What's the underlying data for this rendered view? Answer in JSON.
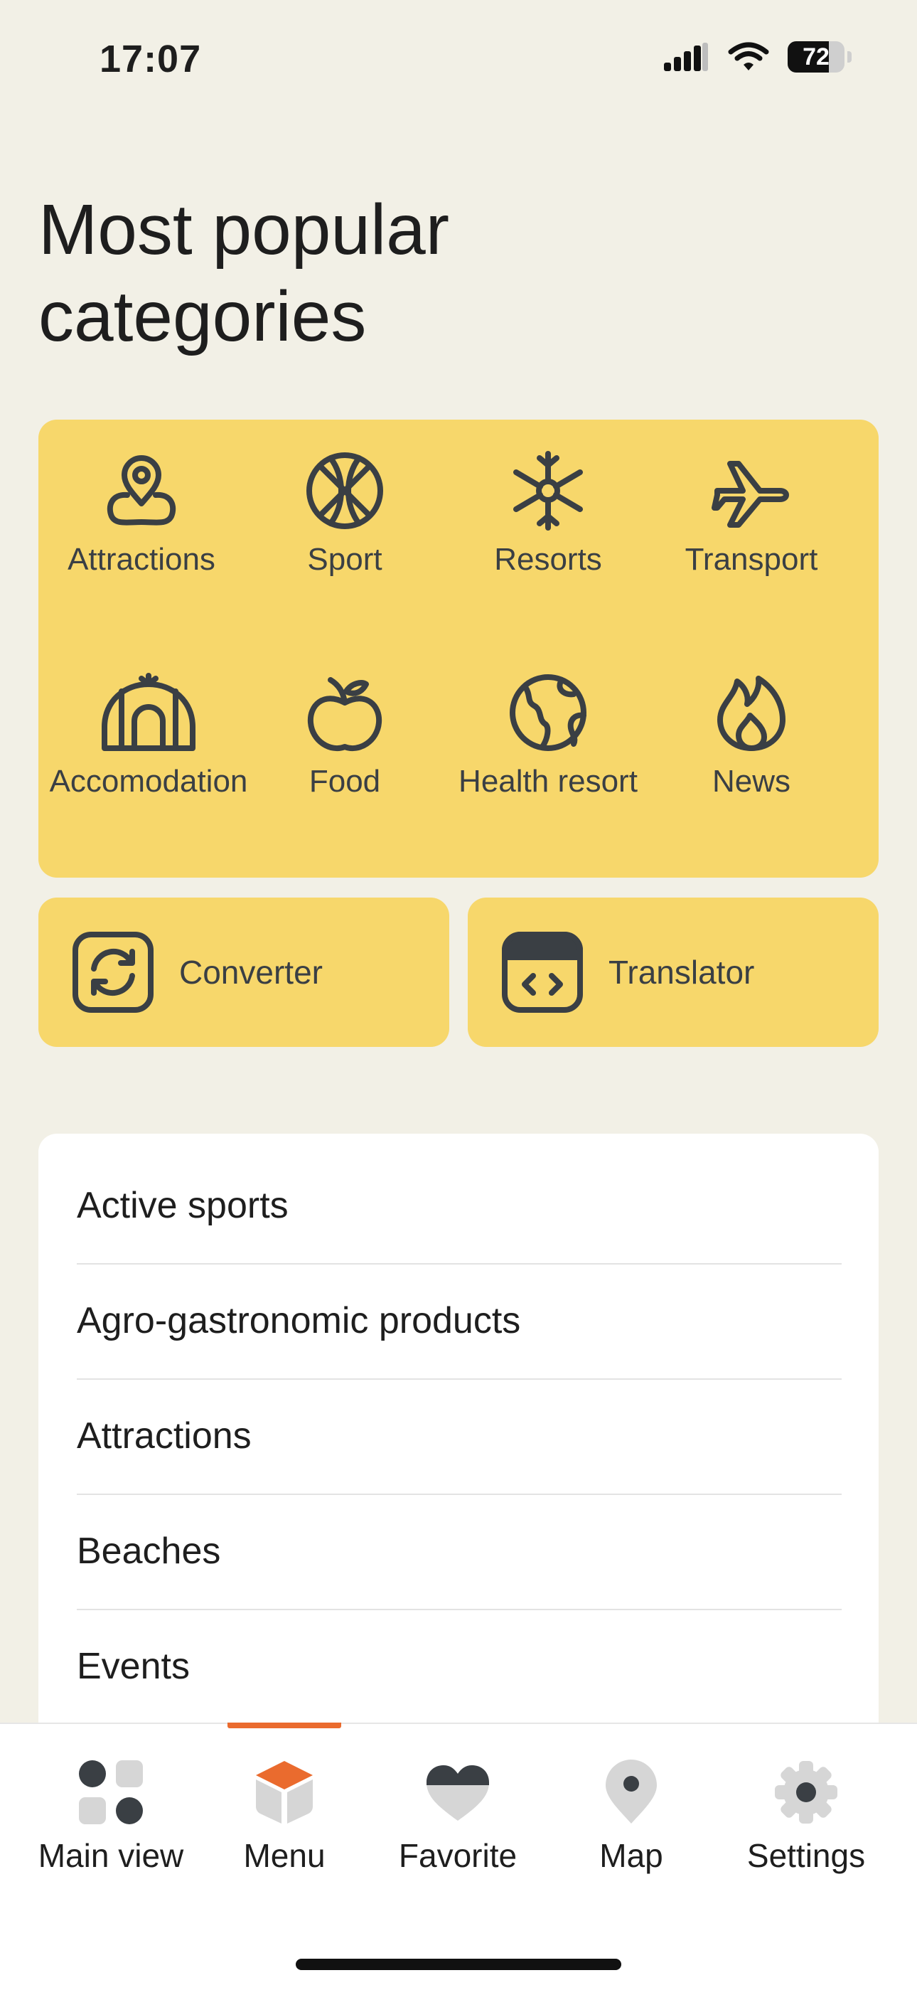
{
  "status": {
    "time": "17:07",
    "battery": "72",
    "battery_level": 0.72
  },
  "page": {
    "title": "Most popular categories"
  },
  "categories": [
    {
      "label": "Attractions",
      "icon": "map-pin-icon"
    },
    {
      "label": "Sport",
      "icon": "basketball-icon"
    },
    {
      "label": "Resorts",
      "icon": "snowflake-icon"
    },
    {
      "label": "Transport",
      "icon": "airplane-icon"
    },
    {
      "label": "Accomodation",
      "icon": "tent-icon"
    },
    {
      "label": "Food",
      "icon": "apple-icon"
    },
    {
      "label": "Health resort",
      "icon": "globe-icon"
    },
    {
      "label": "News",
      "icon": "flame-icon"
    }
  ],
  "tools": [
    {
      "label": "Converter",
      "icon": "refresh-icon"
    },
    {
      "label": "Translator",
      "icon": "code-window-icon"
    }
  ],
  "list": [
    {
      "label": "Active sports"
    },
    {
      "label": "Agro-gastronomic products"
    },
    {
      "label": "Attractions"
    },
    {
      "label": "Beaches"
    },
    {
      "label": "Events"
    }
  ],
  "tabs": [
    {
      "label": "Main view",
      "icon": "grid-icon"
    },
    {
      "label": "Menu",
      "icon": "cube-icon",
      "active": true
    },
    {
      "label": "Favorite",
      "icon": "heart-icon"
    },
    {
      "label": "Map",
      "icon": "location-pin-icon"
    },
    {
      "label": "Settings",
      "icon": "gear-icon"
    }
  ],
  "colors": {
    "background": "#F2F0E6",
    "card_yellow": "#F7D76B",
    "icon_dark": "#3A3F44",
    "accent_orange": "#EA6B2E",
    "inactive_gray": "#D6D6D6"
  }
}
